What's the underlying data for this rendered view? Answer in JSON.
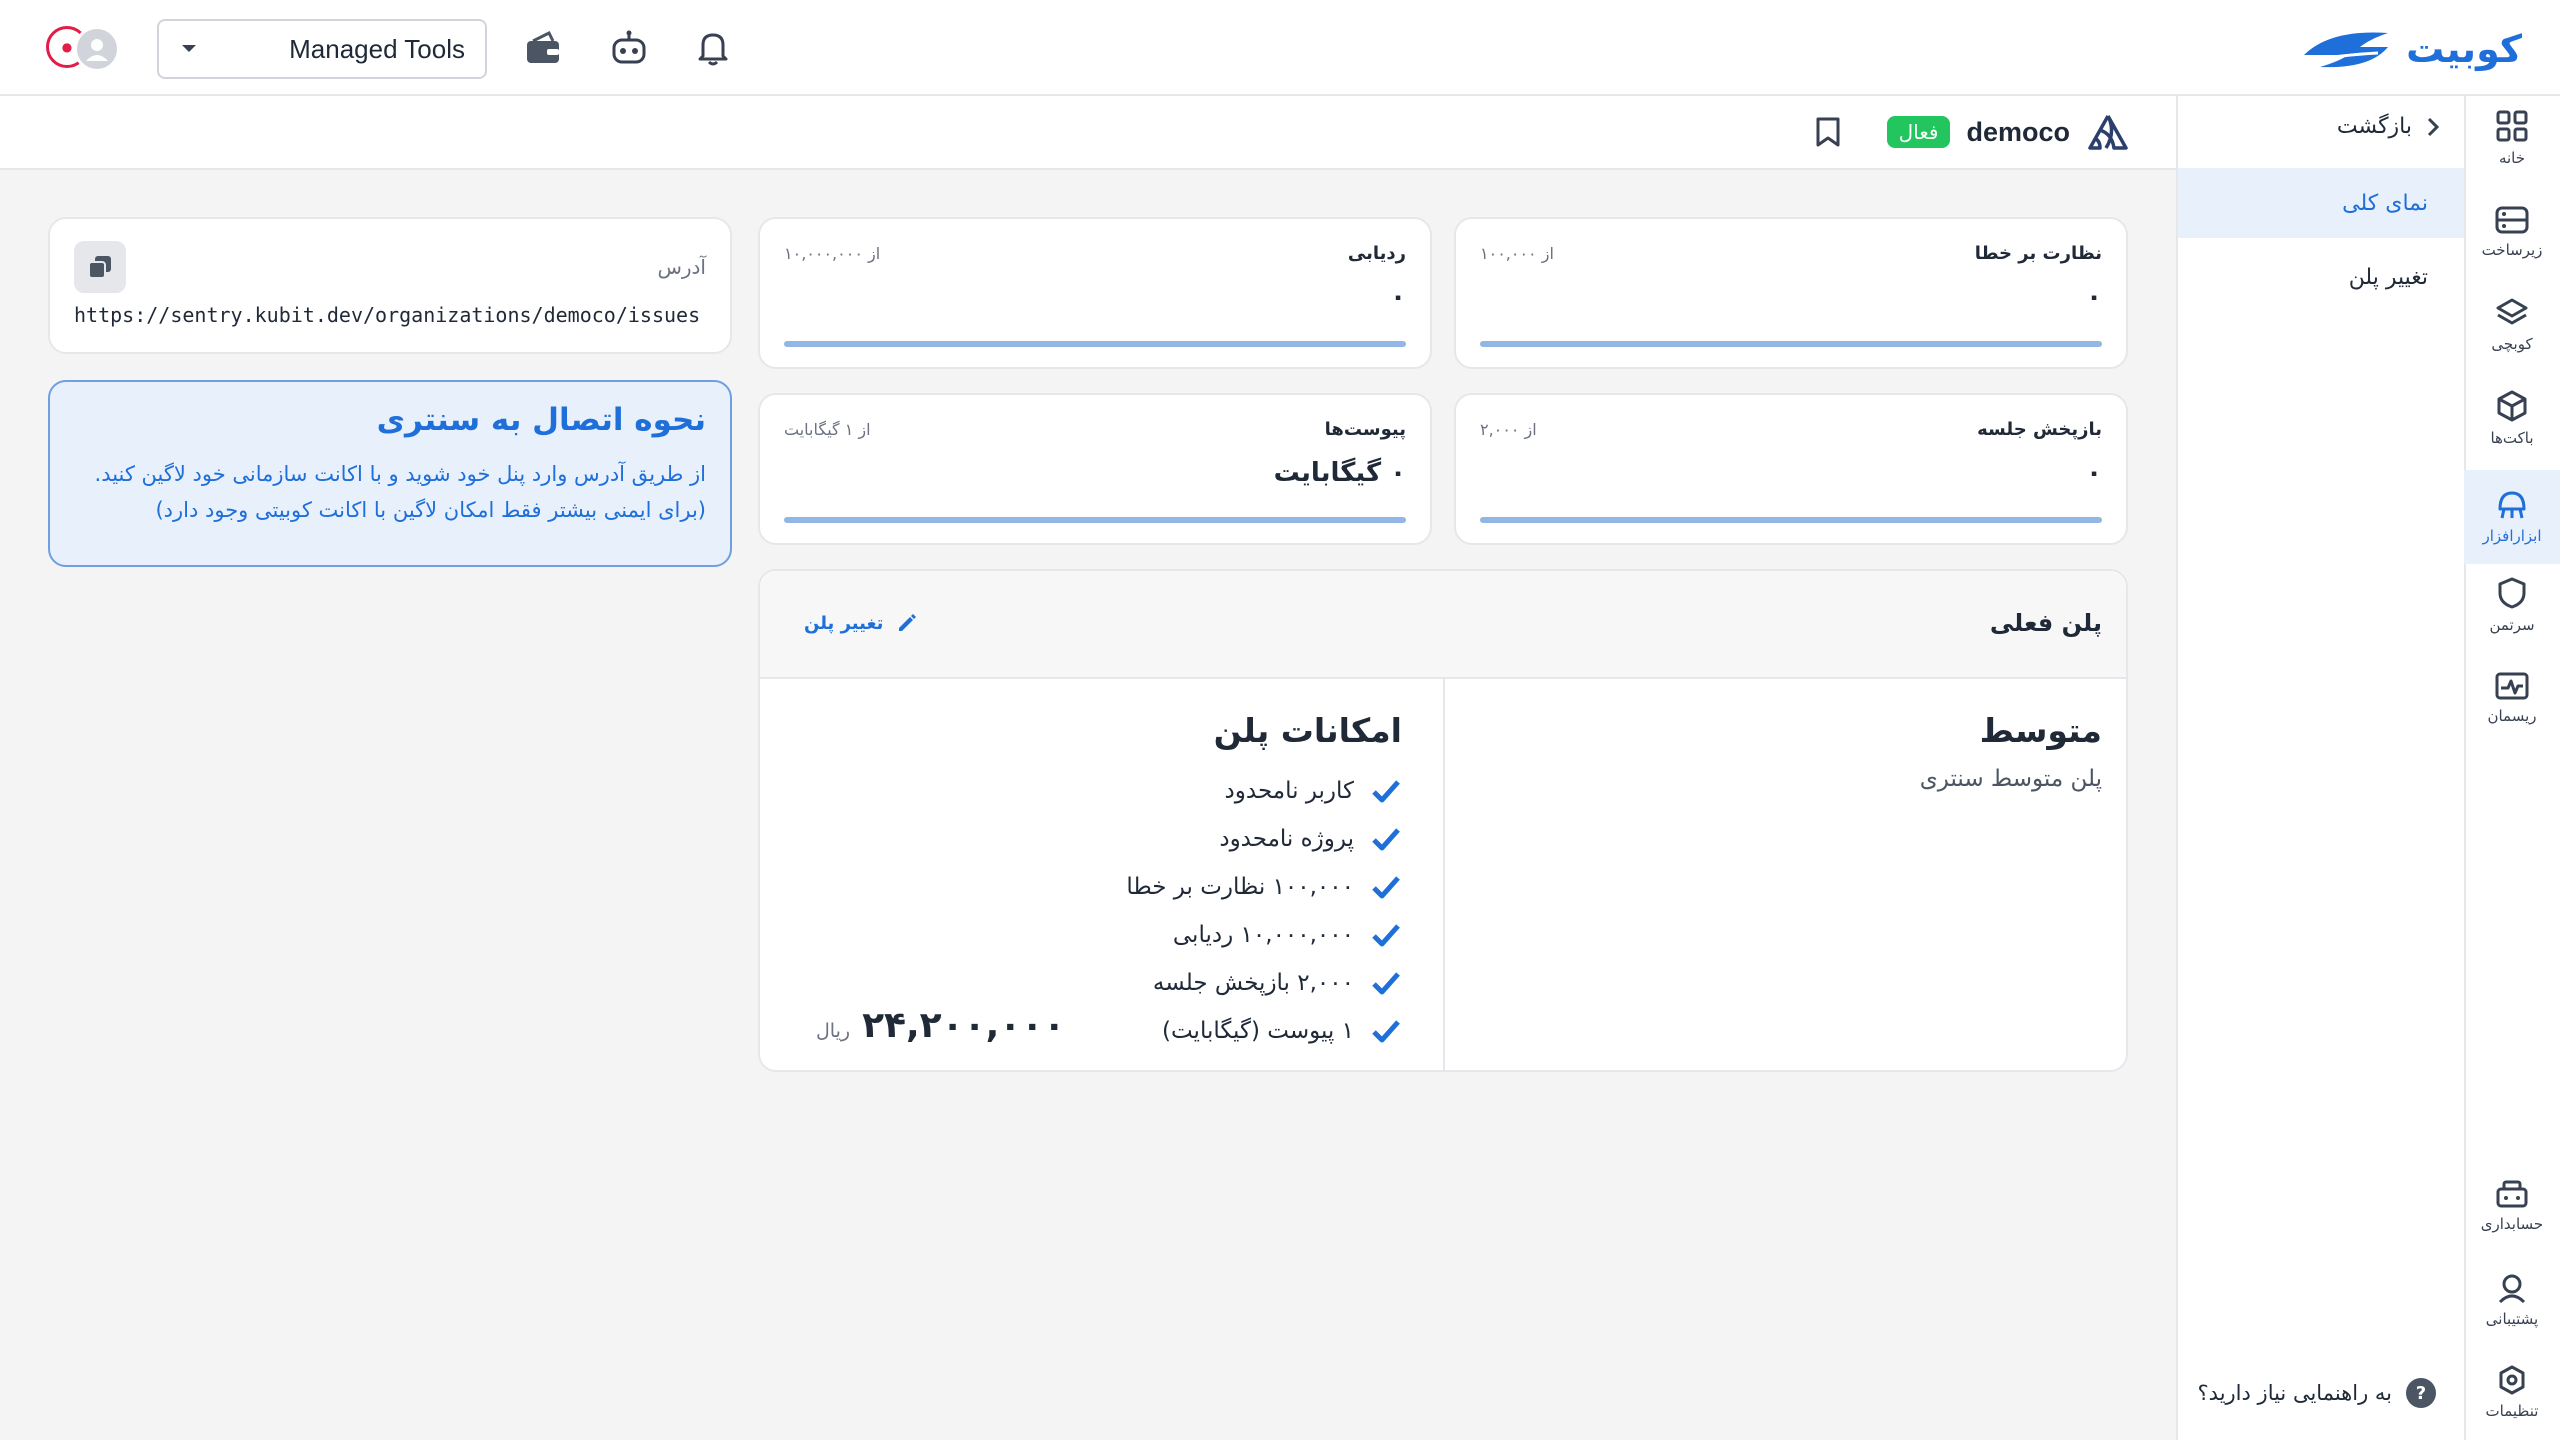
{
  "brand": {
    "name": "کوبیت",
    "color": "#1e6fd9"
  },
  "topbar": {
    "tool_select": {
      "value": "Managed Tools"
    },
    "icons": [
      "bell-icon",
      "robot-icon",
      "wallet-icon"
    ]
  },
  "project": {
    "name": "democo",
    "status": "فعال"
  },
  "subnav": {
    "back": "بازگشت",
    "items": [
      {
        "label": "نمای کلی",
        "active": true
      },
      {
        "label": "تغییر پلن",
        "active": false
      }
    ],
    "help": "به راهنمایی نیاز دارید؟"
  },
  "rail": {
    "items": [
      {
        "label": "خانه",
        "icon": "grid-icon"
      },
      {
        "label": "زیرساخت",
        "icon": "server-icon"
      },
      {
        "label": "کوبچی",
        "icon": "layers-icon"
      },
      {
        "label": "باکت‌ها",
        "icon": "box-icon"
      },
      {
        "label": "ابزارافزار",
        "icon": "tools-icon",
        "active": true
      },
      {
        "label": "سرتمن",
        "icon": "shield-icon"
      },
      {
        "label": "ریسمان",
        "icon": "monitor-icon"
      }
    ],
    "bottom": [
      {
        "label": "حسابداری",
        "icon": "accounting-icon"
      },
      {
        "label": "پشتیبانی",
        "icon": "support-icon"
      },
      {
        "label": "تنظیمات",
        "icon": "settings-icon"
      }
    ]
  },
  "metrics": [
    {
      "title": "نظارت بر خطا",
      "of": "از ۱۰۰,۰۰۰",
      "value": "۰",
      "progress": 0
    },
    {
      "title": "ردیابی",
      "of": "از ۱۰,۰۰۰,۰۰۰",
      "value": "۰",
      "progress": 0
    },
    {
      "title": "بازپخش جلسه",
      "of": "از ۲,۰۰۰",
      "value": "۰",
      "progress": 0
    },
    {
      "title": "پیوست‌ها",
      "of": "از ۱ گیگابایت",
      "value": "۰ گیگابایت",
      "progress": 0
    }
  ],
  "address": {
    "label": "آدرس",
    "url": "https://sentry.kubit.dev/organizations/democo/issues"
  },
  "info": {
    "title": "نحوه اتصال به سنتری",
    "body": "از طریق آدرس وارد پنل خود شوید و با اکانت سازمانی خود لاگین کنید.(برای ایمنی بیشتر فقط امکان لاگین با اکانت کوبیتی وجود دارد)"
  },
  "plan": {
    "header": "پلن فعلی",
    "edit_label": "تغییر پلن",
    "name": "متوسط",
    "description": "پلن متوسط سنتری",
    "price": "۲۴,۲۰۰,۰۰۰",
    "currency": "ریال",
    "features_title": "امکانات پلن",
    "features": [
      "کاربر نامحدود",
      "پروژه نامحدود",
      "۱۰۰,۰۰۰ نظارت بر خطا",
      "۱۰,۰۰۰,۰۰۰ ردیابی",
      "۲,۰۰۰ بازپخش جلسه",
      "۱ پیوست (گیگابایت)"
    ]
  }
}
